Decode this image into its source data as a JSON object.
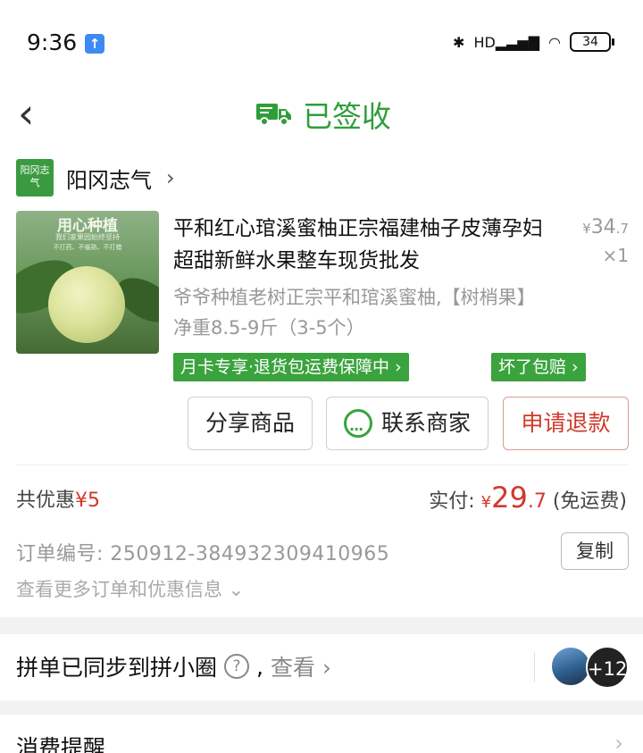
{
  "status_bar": {
    "time": "9:36",
    "battery": "34",
    "signal": "HD"
  },
  "nav": {
    "back_symbol": "‹",
    "title": "已签收"
  },
  "store": {
    "logo_text": "阳冈志气",
    "name": "阳冈志气",
    "chevron": "›"
  },
  "product": {
    "image_text": {
      "title": "用心种植",
      "subtitle": "我们家果园始终坚持",
      "tags": "不打药、不催熟、不打蜡"
    },
    "title": "平和红心琯溪蜜柚正宗福建柚子皮薄孕妇超甜新鲜水果整车现货批发",
    "price_symbol": "¥",
    "price_int": "34",
    "price_dec": ".7",
    "quantity": "×1",
    "spec": "爷爷种植老树正宗平和琯溪蜜柚,【树梢果】净重8.5-9斤（3-5个）",
    "tags": [
      "月卡专享·退货包运费保障中 ›",
      "坏了包赔 ›"
    ]
  },
  "actions": {
    "share": "分享商品",
    "contact": "联系商家",
    "refund": "申请退款"
  },
  "summary": {
    "discount_label": "共优惠",
    "discount_value": "¥5",
    "paid_label": "实付:",
    "paid_symbol": "¥",
    "paid_int": "29",
    "paid_dec": ".7",
    "shipping": "(免运费)"
  },
  "order": {
    "number_label": "订单编号:",
    "number": "250912-384932309410965",
    "copy": "复制",
    "more": "查看更多订单和优惠信息 ⌄"
  },
  "sync": {
    "text": "拼单已同步到拼小圈",
    "help": "?",
    "comma": ",",
    "view": "查看 ›",
    "more_count": "+12"
  },
  "reminder": {
    "text": "消费提醒",
    "chevron": "›"
  },
  "colors": {
    "green": "#3aa33d",
    "title_green": "#2f9e3a",
    "red": "#d0392b"
  }
}
